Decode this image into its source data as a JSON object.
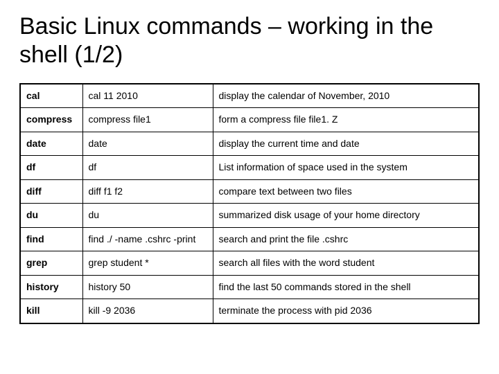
{
  "title": "Basic Linux commands – working in the shell (1/2)",
  "rows": [
    {
      "cmd": "cal",
      "example": "cal 11 2010",
      "desc": "display the calendar of November, 2010"
    },
    {
      "cmd": "compress",
      "example": "compress file1",
      "desc": "form a compress file file1. Z"
    },
    {
      "cmd": "date",
      "example": "date",
      "desc": "display the current time and date"
    },
    {
      "cmd": "df",
      "example": "df",
      "desc": "List information of space used in the system"
    },
    {
      "cmd": "diff",
      "example": "diff f1 f2",
      "desc": "compare text between two files"
    },
    {
      "cmd": "du",
      "example": "du",
      "desc": "summarized disk usage of your home directory"
    },
    {
      "cmd": "find",
      "example": "find ./ -name .cshrc -print",
      "desc": "search and print the file .cshrc"
    },
    {
      "cmd": "grep",
      "example": "grep student *",
      "desc": "search all files with the word student"
    },
    {
      "cmd": "history",
      "example": "history 50",
      "desc": "find the last 50 commands stored in the shell"
    },
    {
      "cmd": "kill",
      "example": "kill -9 2036",
      "desc": "terminate the process with pid 2036"
    }
  ]
}
